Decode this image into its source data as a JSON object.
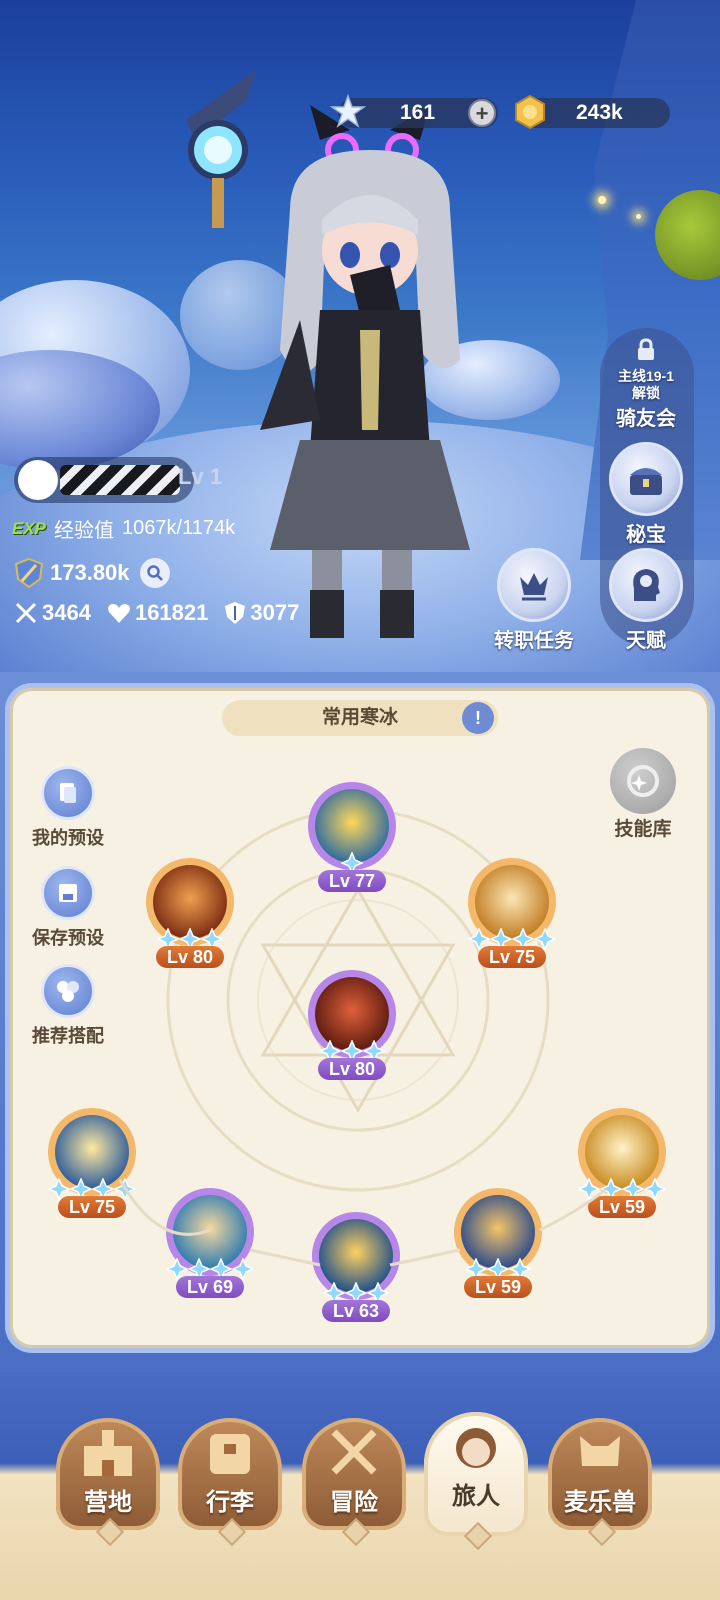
{
  "currency": {
    "star_value": "161",
    "plus_label": "+",
    "gold_value": "243k"
  },
  "player": {
    "level": "Lv 1",
    "exp_badge": "EXP",
    "exp_label": "经验值",
    "exp_value": "1067k/1174k",
    "power": "173.80k",
    "attack": "3464",
    "hp": "161821",
    "defense": "3077"
  },
  "side_menu": {
    "unlock_line1": "主线19-1",
    "unlock_line2": "解锁",
    "knight_club": "骑友会",
    "treasure": "秘宝",
    "talent": "天赋",
    "job_quest": "转职任务"
  },
  "panel": {
    "title": "常用寒冰",
    "title_icon": "!",
    "my_preset": "我的预设",
    "save_preset": "保存预设",
    "recommend": "推荐搭配",
    "skill_library": "技能库"
  },
  "skills": [
    {
      "level": "Lv 77",
      "color": "purple"
    },
    {
      "level": "Lv 80",
      "color": "orange"
    },
    {
      "level": "Lv 75",
      "color": "orange"
    },
    {
      "level": "Lv 80",
      "color": "purple"
    },
    {
      "level": "Lv 75",
      "color": "orange"
    },
    {
      "level": "Lv 59",
      "color": "orange"
    },
    {
      "level": "Lv 69",
      "color": "purple"
    },
    {
      "level": "Lv 63",
      "color": "purple"
    },
    {
      "level": "Lv 59",
      "color": "orange"
    }
  ],
  "nav": {
    "camp": "营地",
    "luggage": "行李",
    "adventure": "冒险",
    "traveler": "旅人",
    "pets": "麦乐兽"
  },
  "colors": {
    "panel_bg": "#f7f1e3",
    "orange_badge": "#c8602a",
    "purple_badge": "#8c5ac8",
    "gem": "#8fd8ff"
  }
}
